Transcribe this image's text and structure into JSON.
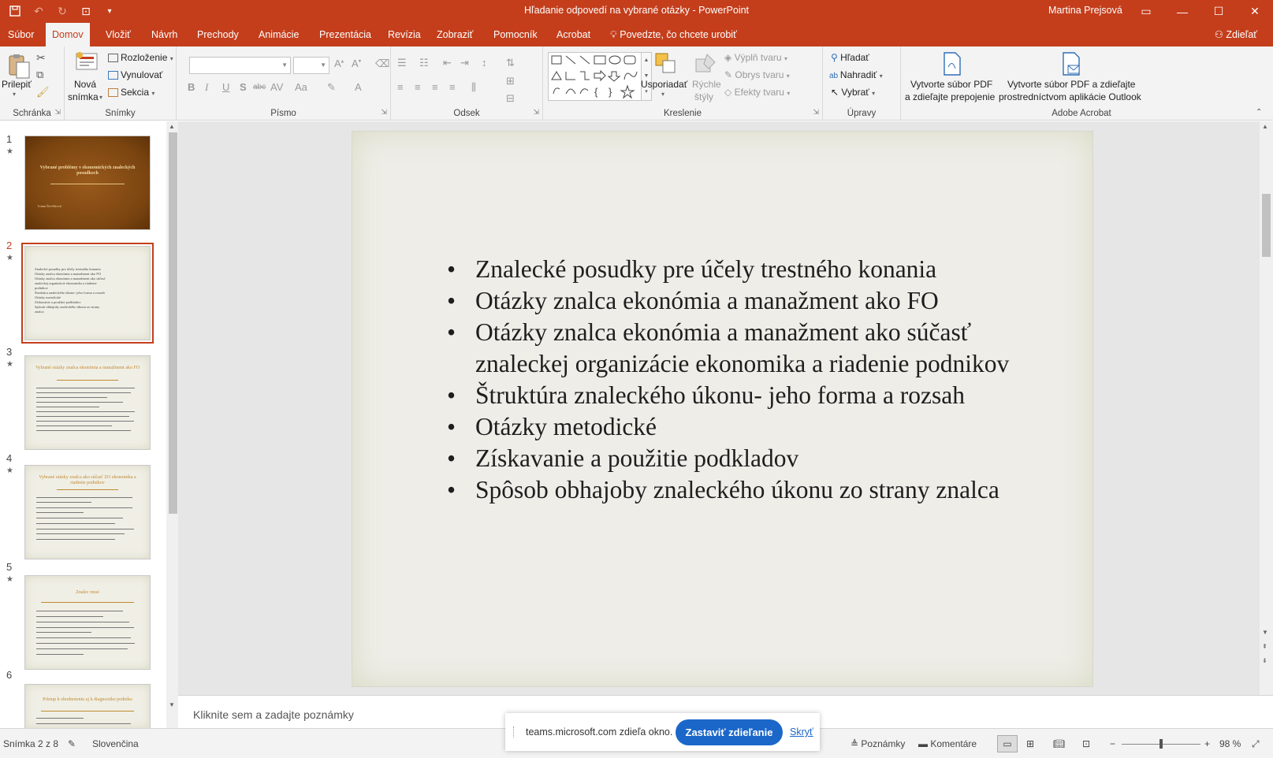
{
  "window": {
    "title": "Hľadanie odpovedí na vybrané otázky  -  PowerPoint",
    "user": "Martina Prejsová"
  },
  "tabs": [
    "Súbor",
    "Domov",
    "Vložiť",
    "Návrh",
    "Prechody",
    "Animácie",
    "Prezentácia",
    "Revízia",
    "Zobraziť",
    "Pomocník",
    "Acrobat"
  ],
  "active_tab": "Domov",
  "tell_me": "Povedzte, čo chcete urobiť",
  "share_label": "Zdieľať",
  "ribbon": {
    "clipboard": {
      "paste": "Prilepiť",
      "label": "Schránka"
    },
    "slides": {
      "new_slide_1": "Nová",
      "new_slide_2": "snímka",
      "layout": "Rozloženie",
      "reset": "Vynulovať",
      "section": "Sekcia",
      "label": "Snímky"
    },
    "font": {
      "label": "Písmo",
      "bold": "B",
      "italic": "I",
      "underline": "U",
      "shadow": "S",
      "strike": "abc",
      "spacing": "AV",
      "case": "Aa"
    },
    "paragraph": {
      "label": "Odsek"
    },
    "drawing": {
      "arrange": "Usporiadať",
      "quick_styles_1": "Rýchle",
      "quick_styles_2": "štýly",
      "fill": "Výplň tvaru",
      "outline": "Obrys tvaru",
      "effects": "Efekty tvaru",
      "label": "Kreslenie"
    },
    "editing": {
      "find": "Hľadať",
      "replace": "Nahradiť",
      "select": "Vybrať",
      "label": "Úpravy"
    },
    "acrobat": {
      "pdf_share_1": "Vytvorte súbor PDF",
      "pdf_share_2": "a zdieľajte prepojenie",
      "pdf_outlook_1": "Vytvorte súbor PDF a zdieľajte",
      "pdf_outlook_2": "prostredníctvom aplikácie Outlook",
      "label": "Adobe Acrobat"
    }
  },
  "thumbnails": {
    "numbers": [
      "1",
      "2",
      "3",
      "4",
      "5",
      "6"
    ],
    "t1_title": "Vybrané problémy v ekonomických znaleckých posudkoch",
    "t1_author": "Ivana Ševčíková",
    "t2_items": [
      "Znalecké posudky pre účely trestného konania",
      "Otázky znalca ekonómia a manažment ako FO",
      "Otázky znalca ekonómia a manažment ako súčasť",
      "znaleckej organizácie ekonomika a riadenie",
      "podnikov",
      "Štruktúra znaleckého úkonu- jeho forma a rozsah",
      "Otázky metodické",
      "Získavanie a použitie podkladov",
      "Spôsob obhajoby znaleckého úkonu zo strany",
      "znalca"
    ],
    "t3_title": "Vybrané otázky znalca ekonómia a manažment ako FO",
    "t4_title": "Vybrané otázky znalca ako súčasť ZO ekonomika a riadenie podnikov",
    "t5_title": "Znalec musí",
    "t6_title": "Prístup k ohodnoteniu aj k diagnostike podniku"
  },
  "slide": {
    "bullets": [
      "Znalecké posudky pre účely trestného konania",
      "Otázky znalca ekonómia a manažment ako FO",
      "Otázky znalca ekonómia a manažment ako súčasť znaleckej organizácie ekonomika a riadenie podnikov",
      "Štruktúra znaleckého úkonu- jeho forma a rozsah",
      "Otázky metodické",
      "Získavanie a použitie podkladov",
      "Spôsob obhajoby znaleckého úkonu zo strany znalca"
    ]
  },
  "notes_placeholder": "Kliknite sem a zadajte poznámky",
  "sharing": {
    "message": "teams.microsoft.com zdieľa okno.",
    "stop": "Zastaviť zdieľanie",
    "hide": "Skryť"
  },
  "status": {
    "slide_count": "Snímka 2 z 8",
    "language": "Slovenčina",
    "notes": "Poznámky",
    "comments": "Komentáre",
    "zoom": "98 %"
  },
  "colors": {
    "accent": "#c43e1c",
    "share_button": "#1b67c9"
  }
}
